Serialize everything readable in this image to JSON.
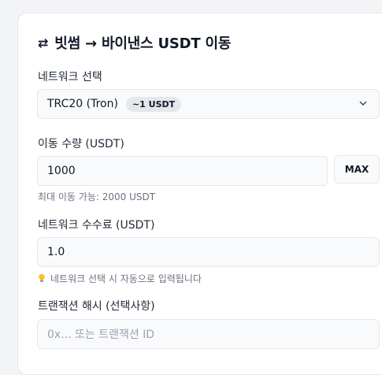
{
  "title": {
    "icon": "⇄",
    "text": "빗썸 → 바이낸스 USDT 이동"
  },
  "network": {
    "label": "네트워크 선택",
    "selected": "TRC20 (Tron)",
    "badge": "~1 USDT"
  },
  "amount": {
    "label": "이동 수량 (USDT)",
    "value": "1000",
    "max_label": "MAX",
    "hint": "최대 이동 가능: 2000 USDT"
  },
  "fee": {
    "label": "네트워크 수수료 (USDT)",
    "value": "1.0",
    "hint": "네트워크 선택 시 자동으로 입력됩니다"
  },
  "tx": {
    "label": "트랜잭션 해시 (선택사항)",
    "placeholder": "0x... 또는 트랜잭션 ID"
  }
}
